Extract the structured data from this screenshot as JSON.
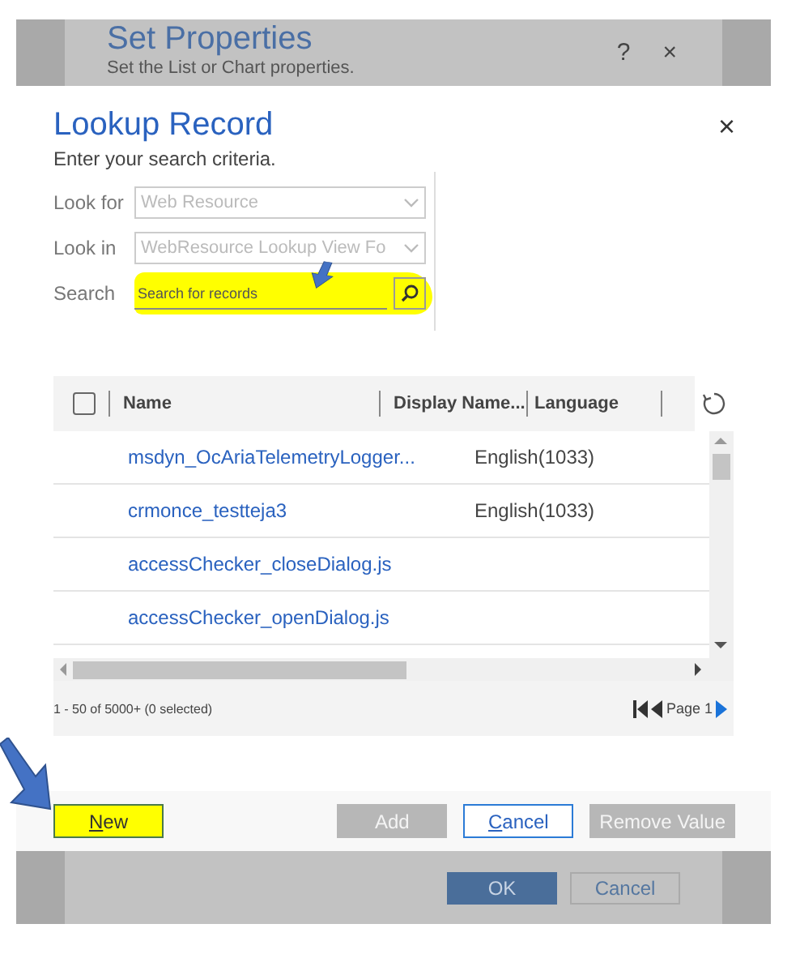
{
  "background_dialog": {
    "title": "Set Properties",
    "subtitle": "Set the List or Chart properties.",
    "help": "?",
    "close": "×",
    "buttons": [
      {
        "label": "OK",
        "kind": "primary"
      },
      {
        "label": "Cancel",
        "kind": "secondary"
      }
    ]
  },
  "lookup_dialog": {
    "title": "Lookup Record",
    "subtitle": "Enter your search criteria.",
    "close": "×",
    "fields": [
      {
        "label": "Look for",
        "value": "Web Resource",
        "disabled": true
      },
      {
        "label": "Look in",
        "value": "WebResource Lookup View Fo",
        "disabled": true
      }
    ],
    "search": {
      "label": "Search",
      "placeholder": "Search for records",
      "highlighted": true
    },
    "table": {
      "select_all_checked": false,
      "columns": [
        "Name",
        "Display Name...",
        "Language"
      ],
      "rows": [
        {
          "name": "msdyn_OcAriaTelemetryLogger...",
          "language": "English(1033)"
        },
        {
          "name": "crmonce_testteja3",
          "language": "English(1033)"
        },
        {
          "name": "accessChecker_closeDialog.js"
        },
        {
          "name": "accessChecker_openDialog.js"
        }
      ],
      "status": "1 - 50 of 5000+ (0 selected)",
      "page": "Page 1"
    },
    "buttons": [
      {
        "label": "New",
        "kind": "new",
        "disabled": false,
        "highlighted": true
      },
      {
        "label": "Add",
        "kind": "action",
        "disabled": true,
        "highlighted": false
      },
      {
        "label": "Cancel",
        "kind": "cancel",
        "disabled": false,
        "highlighted": false
      },
      {
        "label": "Remove Value",
        "kind": "action",
        "disabled": true,
        "highlighted": false
      }
    ]
  }
}
